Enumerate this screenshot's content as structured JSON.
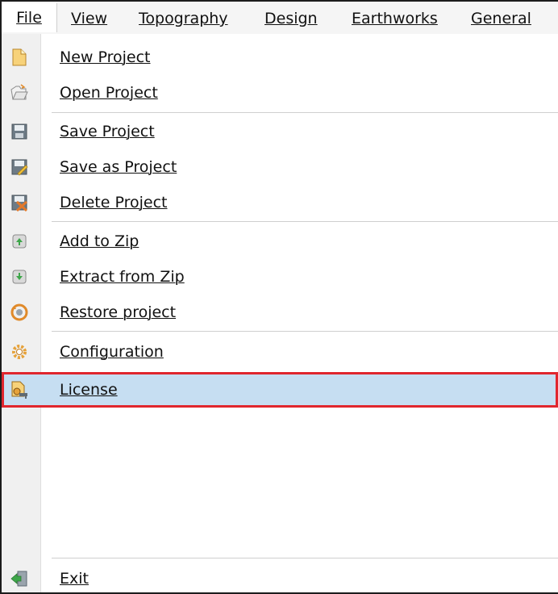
{
  "menubar": {
    "items": [
      {
        "label": "File"
      },
      {
        "label": "View"
      },
      {
        "label": "Topography"
      },
      {
        "label": "Design"
      },
      {
        "label": "Earthworks"
      },
      {
        "label": "General"
      }
    ]
  },
  "file_menu": {
    "items": [
      {
        "label": "New Project",
        "icon": "new-document-icon"
      },
      {
        "label": "Open Project",
        "icon": "open-folder-icon"
      },
      {
        "label": "Save Project",
        "icon": "floppy-disk-icon"
      },
      {
        "label": "Save as Project",
        "icon": "save-as-icon"
      },
      {
        "label": "Delete Project",
        "icon": "delete-icon"
      },
      {
        "label": "Add to Zip",
        "icon": "zip-add-icon"
      },
      {
        "label": "Extract from Zip",
        "icon": "zip-extract-icon"
      },
      {
        "label": "Restore project",
        "icon": "restore-icon"
      },
      {
        "label": "Configuration",
        "icon": "gear-icon"
      },
      {
        "label": "License",
        "icon": "license-icon",
        "highlighted": true
      },
      {
        "label": "Exit",
        "icon": "exit-icon"
      }
    ]
  },
  "colors": {
    "highlight": "#c6def2",
    "highlight_border": "#e0262e"
  }
}
